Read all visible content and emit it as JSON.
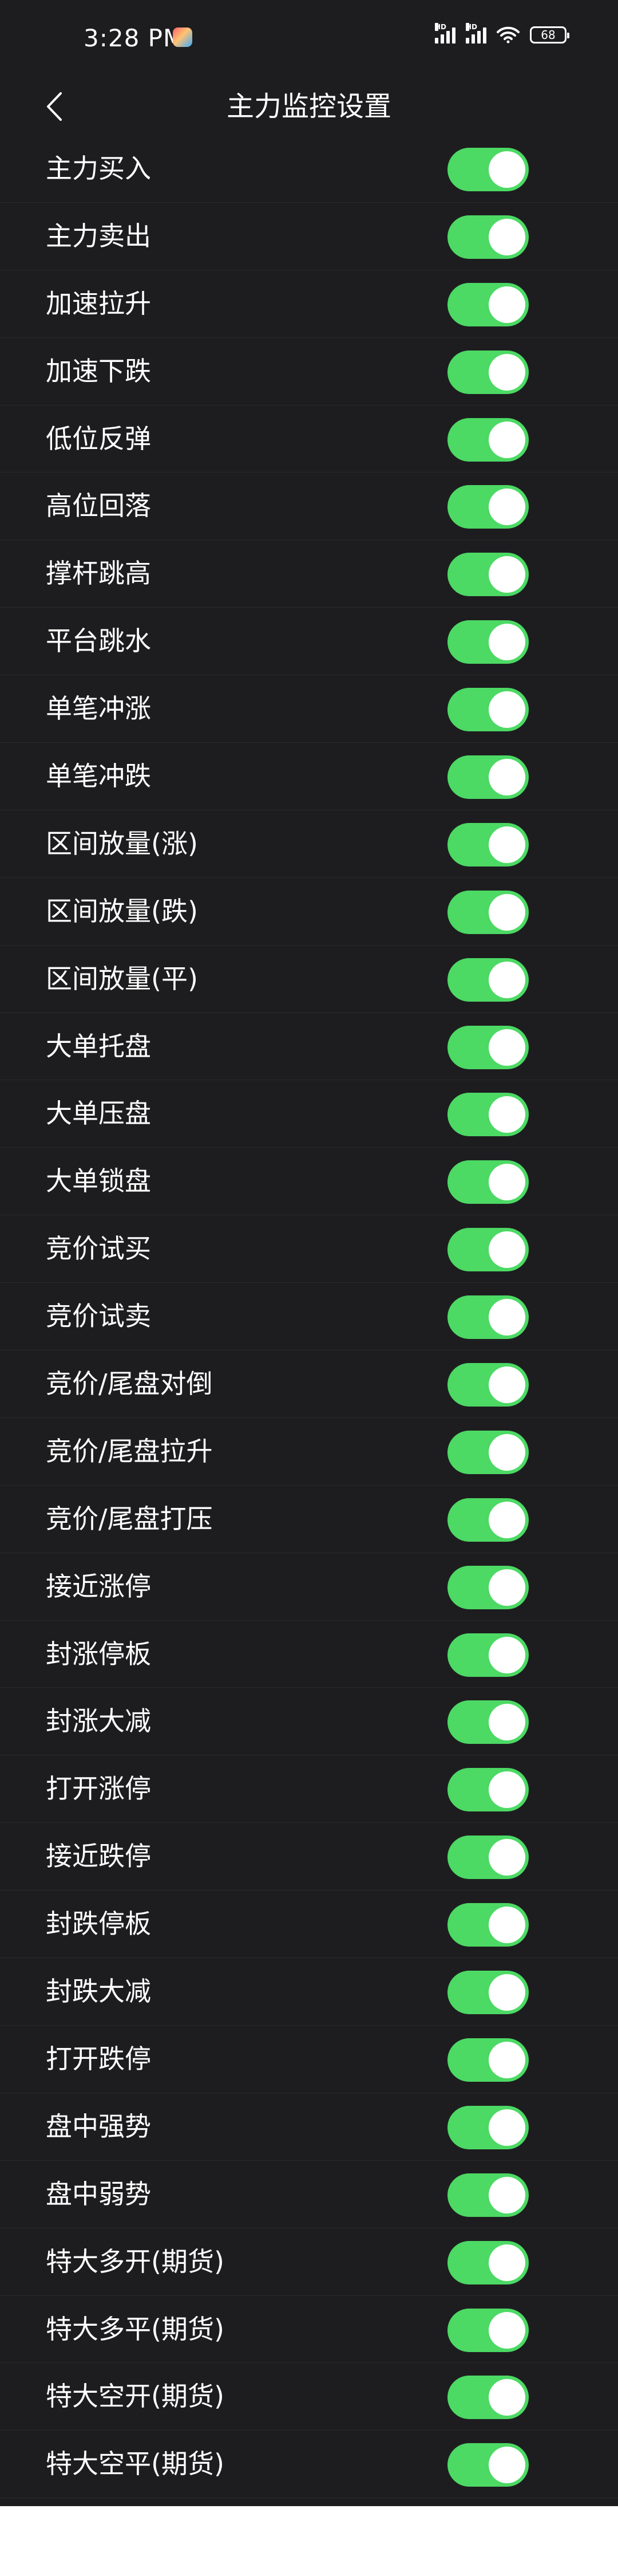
{
  "status_bar": {
    "time": "3:28 PM",
    "signal1_label": "HD",
    "signal2_label": "HD",
    "battery": "68"
  },
  "header": {
    "title": "主力监控设置"
  },
  "colors": {
    "background": "#1d1d1f",
    "toggle_on": "#4cd964",
    "text": "#ffffff"
  },
  "settings": [
    {
      "label": "主力买入",
      "enabled": true
    },
    {
      "label": "主力卖出",
      "enabled": true
    },
    {
      "label": "加速拉升",
      "enabled": true
    },
    {
      "label": "加速下跌",
      "enabled": true
    },
    {
      "label": "低位反弹",
      "enabled": true
    },
    {
      "label": "高位回落",
      "enabled": true
    },
    {
      "label": "撑杆跳高",
      "enabled": true
    },
    {
      "label": "平台跳水",
      "enabled": true
    },
    {
      "label": "单笔冲涨",
      "enabled": true
    },
    {
      "label": "单笔冲跌",
      "enabled": true
    },
    {
      "label": "区间放量(涨)",
      "enabled": true
    },
    {
      "label": "区间放量(跌)",
      "enabled": true
    },
    {
      "label": "区间放量(平)",
      "enabled": true
    },
    {
      "label": "大单托盘",
      "enabled": true
    },
    {
      "label": "大单压盘",
      "enabled": true
    },
    {
      "label": "大单锁盘",
      "enabled": true
    },
    {
      "label": "竞价试买",
      "enabled": true
    },
    {
      "label": "竞价试卖",
      "enabled": true
    },
    {
      "label": "竞价/尾盘对倒",
      "enabled": true
    },
    {
      "label": "竞价/尾盘拉升",
      "enabled": true
    },
    {
      "label": "竞价/尾盘打压",
      "enabled": true
    },
    {
      "label": "接近涨停",
      "enabled": true
    },
    {
      "label": "封涨停板",
      "enabled": true
    },
    {
      "label": "封涨大减",
      "enabled": true
    },
    {
      "label": "打开涨停",
      "enabled": true
    },
    {
      "label": "接近跌停",
      "enabled": true
    },
    {
      "label": "封跌停板",
      "enabled": true
    },
    {
      "label": "封跌大减",
      "enabled": true
    },
    {
      "label": "打开跌停",
      "enabled": true
    },
    {
      "label": "盘中强势",
      "enabled": true
    },
    {
      "label": "盘中弱势",
      "enabled": true
    },
    {
      "label": "特大多开(期货)",
      "enabled": true
    },
    {
      "label": "特大多平(期货)",
      "enabled": true
    },
    {
      "label": "特大空开(期货)",
      "enabled": true
    },
    {
      "label": "特大空平(期货)",
      "enabled": true
    }
  ]
}
